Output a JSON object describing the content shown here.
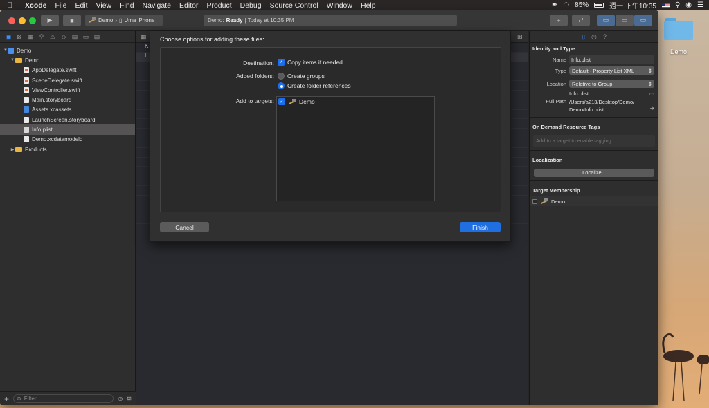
{
  "menubar": {
    "app_name": "Xcode",
    "items": [
      "File",
      "Edit",
      "View",
      "Find",
      "Navigate",
      "Editor",
      "Product",
      "Debug",
      "Source Control",
      "Window",
      "Help"
    ],
    "battery": "85%",
    "clock": "週一 下午10:35"
  },
  "toolbar": {
    "scheme_target": "Demo",
    "scheme_device": "Uma iPhone",
    "activity_project": "Demo:",
    "activity_status": "Ready",
    "activity_time": "| Today at 10:35 PM"
  },
  "navigator": {
    "items": [
      {
        "label": "Demo",
        "kind": "project"
      },
      {
        "label": "Demo",
        "kind": "folder"
      },
      {
        "label": "AppDelegate.swift",
        "kind": "swift"
      },
      {
        "label": "SceneDelegate.swift",
        "kind": "swift"
      },
      {
        "label": "ViewController.swift",
        "kind": "swift"
      },
      {
        "label": "Main.storyboard",
        "kind": "storyboard"
      },
      {
        "label": "Assets.xcassets",
        "kind": "assets"
      },
      {
        "label": "LaunchScreen.storyboard",
        "kind": "storyboard"
      },
      {
        "label": "Info.plist",
        "kind": "plist"
      },
      {
        "label": "Demo.xcdatamodeld",
        "kind": "data"
      },
      {
        "label": "Products",
        "kind": "folder"
      }
    ],
    "filter_placeholder": "Filter"
  },
  "editor": {
    "visible_fragments": [
      "K",
      "I"
    ]
  },
  "inspector": {
    "identity_title": "Identity and Type",
    "name_label": "Name",
    "name_value": "Info.plist",
    "type_label": "Type",
    "type_value": "Default - Property List XML",
    "location_label": "Location",
    "location_value": "Relative to Group",
    "location_file": "Info.plist",
    "fullpath_label": "Full Path",
    "fullpath_value": "/Users/a213/Desktop/Demo/Demo/Info.plist",
    "odr_title": "On Demand Resource Tags",
    "odr_placeholder": "Add to a target to enable tagging",
    "localization_title": "Localization",
    "localize_button": "Localize...",
    "membership_title": "Target Membership",
    "membership_target": "Demo"
  },
  "sheet": {
    "title": "Choose options for adding these files:",
    "destination_label": "Destination:",
    "copy_items": "Copy items if needed",
    "added_folders_label": "Added folders:",
    "create_groups": "Create groups",
    "create_folder_refs": "Create folder references",
    "add_to_targets_label": "Add to targets:",
    "target_name": "Demo",
    "cancel": "Cancel",
    "finish": "Finish"
  },
  "desktop": {
    "folder_label": "Demo"
  }
}
